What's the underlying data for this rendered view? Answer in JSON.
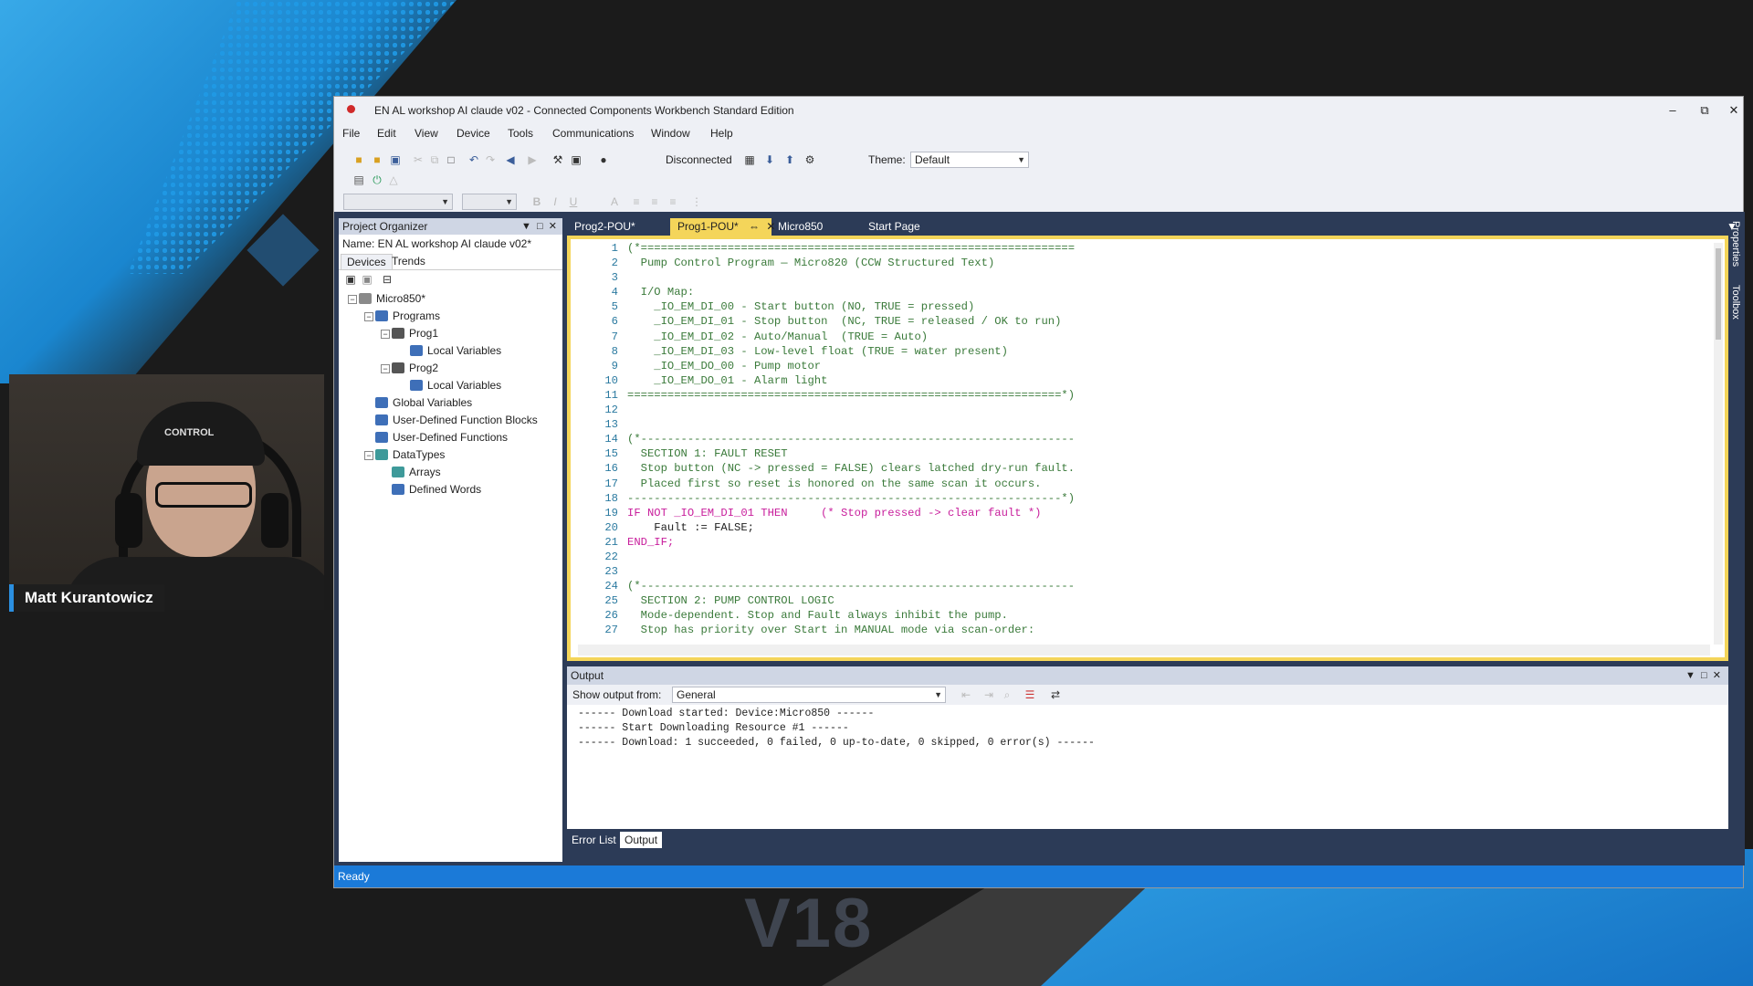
{
  "presenter": {
    "name": "Matt Kurantowicz",
    "cap_text": "CONTROL"
  },
  "overlay": {
    "version": "V18"
  },
  "window": {
    "title": "EN AL workshop AI claude v02 - Connected Components Workbench Standard Edition",
    "controls": {
      "minimize": "‒",
      "restore": "⧉",
      "close": "✕"
    }
  },
  "menu": [
    "File",
    "Edit",
    "View",
    "Device",
    "Tools",
    "Communications",
    "Window",
    "Help"
  ],
  "toolbar": {
    "connection_status": "Disconnected",
    "theme_label": "Theme:",
    "theme_value": "Default"
  },
  "project_organizer": {
    "title": "Project Organizer",
    "name_line": "Name:  EN AL workshop AI claude v02*",
    "tabs": [
      "Devices",
      "Trends"
    ],
    "tree": [
      {
        "label": "Micro850*",
        "icon": "controller-icon",
        "color": "#8a8a8a"
      },
      {
        "label": "Programs",
        "icon": "programs-folder-icon",
        "color": "#3e6fb8"
      },
      {
        "label": "Prog1",
        "icon": "program-icon",
        "color": "#555555"
      },
      {
        "label": "Local Variables",
        "icon": "variables-icon",
        "color": "#3e6fb8"
      },
      {
        "label": "Prog2",
        "icon": "program-icon",
        "color": "#555555"
      },
      {
        "label": "Local Variables",
        "icon": "variables-icon",
        "color": "#3e6fb8"
      },
      {
        "label": "Global Variables",
        "icon": "variables-icon",
        "color": "#3e6fb8"
      },
      {
        "label": "User-Defined Function Blocks",
        "icon": "function-block-icon",
        "color": "#3e6fb8"
      },
      {
        "label": "User-Defined Functions",
        "icon": "function-icon",
        "color": "#3e6fb8"
      },
      {
        "label": "DataTypes",
        "icon": "datatypes-folder-icon",
        "color": "#3e9a9a"
      },
      {
        "label": "Arrays",
        "icon": "arrays-icon",
        "color": "#3e9a9a"
      },
      {
        "label": "Defined Words",
        "icon": "defined-words-icon",
        "color": "#3e6fb8"
      }
    ]
  },
  "editor_tabs": [
    {
      "label": "Prog2-POU*"
    },
    {
      "label": "Prog1-POU*"
    },
    {
      "label": "Micro850"
    },
    {
      "label": "Start Page"
    }
  ],
  "code": [
    {
      "n": "1",
      "t": "(*=================================================================",
      "k": "cmt"
    },
    {
      "n": "2",
      "t": "  Pump Control Program — Micro820 (CCW Structured Text)",
      "k": "cmt"
    },
    {
      "n": "3",
      "t": "",
      "k": "cmt"
    },
    {
      "n": "4",
      "t": "  I/O Map:",
      "k": "cmt"
    },
    {
      "n": "5",
      "t": "    _IO_EM_DI_00 - Start button (NO, TRUE = pressed)",
      "k": "cmt"
    },
    {
      "n": "6",
      "t": "    _IO_EM_DI_01 - Stop button  (NC, TRUE = released / OK to run)",
      "k": "cmt"
    },
    {
      "n": "7",
      "t": "    _IO_EM_DI_02 - Auto/Manual  (TRUE = Auto)",
      "k": "cmt"
    },
    {
      "n": "8",
      "t": "    _IO_EM_DI_03 - Low-level float (TRUE = water present)",
      "k": "cmt"
    },
    {
      "n": "9",
      "t": "    _IO_EM_DO_00 - Pump motor",
      "k": "cmt"
    },
    {
      "n": "10",
      "t": "    _IO_EM_DO_01 - Alarm light",
      "k": "cmt"
    },
    {
      "n": "11",
      "t": "=================================================================*)",
      "k": "cmt"
    },
    {
      "n": "12",
      "t": "",
      "k": "plain"
    },
    {
      "n": "13",
      "t": "",
      "k": "plain"
    },
    {
      "n": "14",
      "t": "(*-----------------------------------------------------------------",
      "k": "cmt"
    },
    {
      "n": "15",
      "t": "  SECTION 1: FAULT RESET",
      "k": "cmt"
    },
    {
      "n": "16",
      "t": "  Stop button (NC -> pressed = FALSE) clears latched dry-run fault.",
      "k": "cmt"
    },
    {
      "n": "17",
      "t": "  Placed first so reset is honored on the same scan it occurs.",
      "k": "cmt"
    },
    {
      "n": "18",
      "t": "-----------------------------------------------------------------*)",
      "k": "cmt"
    },
    {
      "n": "19",
      "t": "IF NOT _IO_EM_DI_01 THEN     (* Stop pressed -> clear fault *)",
      "k": "mix19"
    },
    {
      "n": "20",
      "t": "    Fault := FALSE;",
      "k": "mix20"
    },
    {
      "n": "21",
      "t": "END_IF;",
      "k": "kw"
    },
    {
      "n": "22",
      "t": "",
      "k": "plain"
    },
    {
      "n": "23",
      "t": "",
      "k": "plain"
    },
    {
      "n": "24",
      "t": "(*-----------------------------------------------------------------",
      "k": "cmt"
    },
    {
      "n": "25",
      "t": "  SECTION 2: PUMP CONTROL LOGIC",
      "k": "cmt"
    },
    {
      "n": "26",
      "t": "  Mode-dependent. Stop and Fault always inhibit the pump.",
      "k": "cmt"
    },
    {
      "n": "27",
      "t": "  Stop has priority over Start in MANUAL mode via scan-order:",
      "k": "cmt"
    }
  ],
  "output": {
    "title": "Output",
    "show_from_label": "Show output from:",
    "show_from_value": "General",
    "lines": [
      "------ Download started: Device:Micro850 ------",
      "------ Start Downloading Resource #1 ------",
      "------ Download: 1 succeeded, 0 failed, 0 up-to-date, 0 skipped, 0 error(s) ------"
    ]
  },
  "bottom_tabs": [
    "Error List",
    "Output"
  ],
  "side_tabs": [
    "Properties",
    "Toolbox"
  ],
  "status": "Ready",
  "colors": {
    "accent": "#f4d55a",
    "status_bar": "#1b7ad8",
    "dock": "#2c3b57"
  }
}
